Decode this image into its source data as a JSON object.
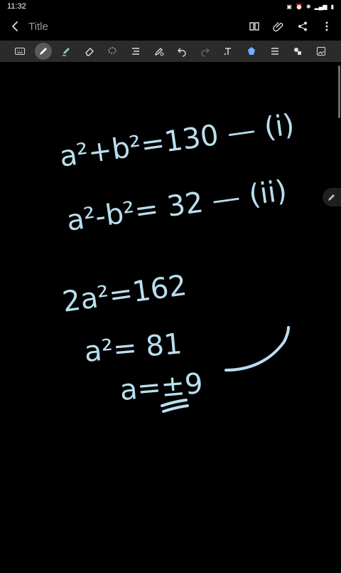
{
  "status_bar": {
    "time": "11:32",
    "indicators": "⋮ ⋮"
  },
  "header": {
    "title": "Title"
  },
  "note": {
    "lines": [
      "a²+b²=130 — (i)",
      "a²-b²= 32 — (ii)",
      "2a²=162",
      "a²=81",
      "a=±9"
    ]
  },
  "colors": {
    "ink": "#b9dfef",
    "toolbar": "#2b2b2b",
    "background": "#000000"
  }
}
